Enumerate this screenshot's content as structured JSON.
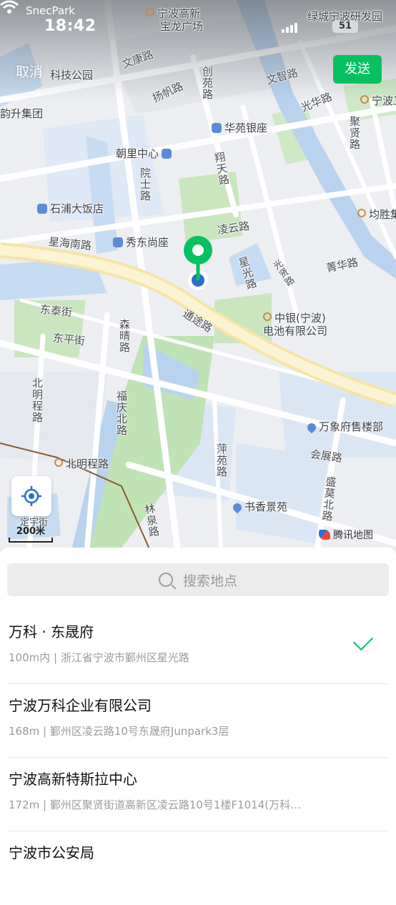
{
  "status_bar": {
    "app_back": "SnecPark",
    "time": "18:42",
    "battery": "51"
  },
  "nav": {
    "cancel": "取消",
    "send": "发送"
  },
  "map": {
    "labels": {
      "ningbo_hitech_baolong": [
        "宁波高新",
        "宝龙广场"
      ],
      "greentown_rd": "绿城宁波研发园",
      "tech_park": "科技公园",
      "wenkang_rd": "文康路",
      "yangfan_rd": "扬帆路",
      "chuangyuan_rd": "创苑路",
      "wenzhi_rd": "文智路",
      "ningbo_cut": "宁波工",
      "yunsheng": "韵升集团",
      "guanghua_rd": "光华路",
      "huayuan_bank": "华苑银座",
      "juxian_rd": "聚贤路",
      "chaoli_center": "朝里中心",
      "yuanshi_rd": "院士路",
      "xiangtian_rd": "翔天路",
      "shipu_hotel": "石浦大饭店",
      "junsheng": "均胜集",
      "xinghai_s_rd": "星海南路",
      "xiudong_shangzuo": "秀东尚座",
      "lingyun_rd": "凌云路",
      "xingguang_rd": "星光路",
      "guangxian_rd": "光贤路",
      "jinghua_rd": "菁华路",
      "tongtu_rd": "通途路",
      "dongtai_st": "东泰街",
      "zhongyin_battery": [
        "中银(宁波)",
        "电池有限公司"
      ],
      "dongping_st": "东平街",
      "senqing_rd": "森晴路",
      "beiming_rd_v": "北明程路",
      "fuqing_n_rd": "福庆北路",
      "wanxiang_sales": "万象府售楼部",
      "huizhan_rd": "会展路",
      "beiming_station": "北明程路",
      "pingyuan_rd": "萍苑路",
      "shengmo_n_rd": "盛莫北路",
      "shuxiang_jingyuan": "书香景苑",
      "linquan_rd": "林泉路",
      "dingyu_jie": "定宇街"
    },
    "scale": "200米",
    "brand": "腾讯地图",
    "colors": {
      "water": "#c6dcf2",
      "park": "#bfe3b4",
      "road": "#ffffff",
      "highway": "#f6e7b3",
      "pin": "#07c160"
    }
  },
  "search": {
    "placeholder": "搜索地点"
  },
  "results": [
    {
      "name": "万科 · 东晟府",
      "addr": "100m内 | 浙江省宁波市鄞州区星光路",
      "selected": true
    },
    {
      "name": "宁波万科企业有限公司",
      "addr": "168m | 鄞州区凌云路10号东晟府Junpark3层",
      "selected": false
    },
    {
      "name": "宁波高新特斯拉中心",
      "addr": "172m | 鄞州区聚贤街道高新区凌云路10号1楼F1014(万科…",
      "selected": false
    },
    {
      "name": "宁波市公安局",
      "addr": "",
      "selected": false
    }
  ]
}
